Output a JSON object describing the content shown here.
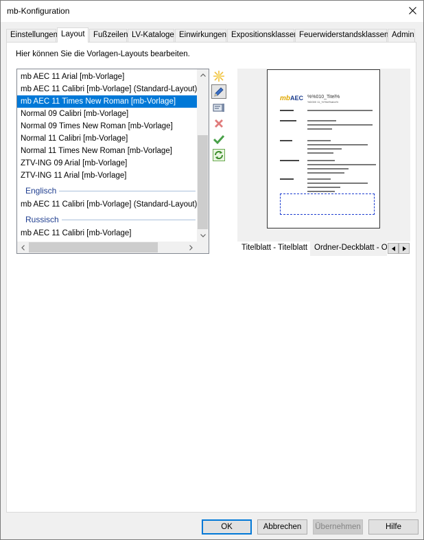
{
  "window": {
    "title": "mb-Konfiguration"
  },
  "tabs": [
    "Einstellungen",
    "Layout",
    "Fußzeilen",
    "LV-Kataloge",
    "Einwirkungen",
    "Expositionsklassen",
    "Feuerwiderstandsklassen",
    "Admin"
  ],
  "active_tab": "Layout",
  "hint": "Hier können Sie die Vorlagen-Layouts bearbeiten.",
  "layouts": {
    "items": [
      "mb AEC 11 Arial [mb-Vorlage]",
      "mb AEC 11 Calibri [mb-Vorlage] (Standard-Layout)",
      "mb AEC 11 Times New Roman [mb-Vorlage]",
      "Normal 09 Calibri [mb-Vorlage]",
      "Normal 09 Times New Roman [mb-Vorlage]",
      "Normal 11 Calibri [mb-Vorlage]",
      "Normal 11 Times New Roman [mb-Vorlage]",
      "ZTV-ING 09 Arial [mb-Vorlage]",
      "ZTV-ING 11 Arial [mb-Vorlage]"
    ],
    "selected": "mb AEC 11 Times New Roman [mb-Vorlage]",
    "group_english": "Englisch",
    "english_items": [
      "mb AEC 11 Calibri [mb-Vorlage] (Standard-Layout)"
    ],
    "group_russian": "Russisch",
    "russian_items": [
      "mb AEC 11 Calibri [mb-Vorlage]"
    ]
  },
  "toolbar_icons": [
    "new-icon",
    "edit-pencil-icon",
    "rename-icon",
    "delete-icon",
    "apply-check-icon",
    "refresh-icon"
  ],
  "preview": {
    "doc_title": "%%010_Titel%",
    "doc_sub": "%D000 11_%Titel%abx%",
    "tabs": [
      "Titelblatt - Titelblatt",
      "Ordner-Deckblatt - Or"
    ]
  },
  "buttons": {
    "ok": "OK",
    "cancel": "Abbrechen",
    "apply": "Übernehmen",
    "help": "Hilfe"
  },
  "colors": {
    "selection": "#0078d7",
    "group_heading": "#1e3d8f",
    "default_button_border": "#0078d7"
  }
}
